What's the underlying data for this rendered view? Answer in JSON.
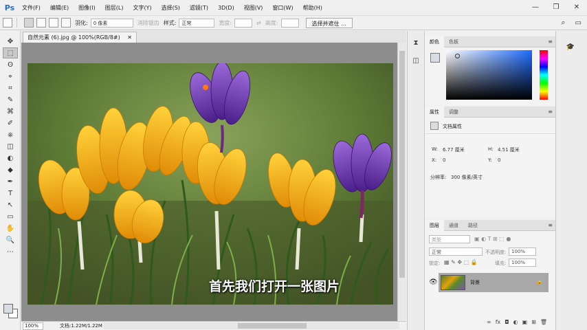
{
  "app": {
    "logo": "Ps"
  },
  "menu": [
    "文件(F)",
    "编辑(E)",
    "图像(I)",
    "图层(L)",
    "文字(Y)",
    "选择(S)",
    "滤镜(T)",
    "3D(D)",
    "视图(V)",
    "窗口(W)",
    "帮助(H)"
  ],
  "window_controls": {
    "minimize": "—",
    "restore": "❐",
    "close": "✕"
  },
  "options": {
    "feather_label": "羽化:",
    "feather_value": "0 像素",
    "antialias_label": "消除锯齿",
    "style_label": "样式:",
    "style_value": "正常",
    "width_label": "宽度:",
    "height_label": "高度:",
    "select_mask_button": "选择并遮住 ..."
  },
  "tools": [
    "✥",
    "⬚",
    "ʘ",
    "⌖",
    "⌗",
    "✎",
    "⌘",
    "✐",
    "⎈",
    "◫",
    "◐",
    "◆",
    "✒",
    "T",
    "↖",
    "▭",
    "✋",
    "🔍",
    "⋯"
  ],
  "document": {
    "tab_title": "自然元素 (6).jpg @ 100%(RGB/8#)",
    "close_glyph": "✕",
    "caption": "首先我们打开一张图片"
  },
  "status": {
    "zoom": "100%",
    "doc": "文档:1.22M/1.22M",
    "arrow": "›"
  },
  "color_panel": {
    "tabs": [
      "颜色",
      "色板"
    ],
    "fg_color": "#d8dde4",
    "bg_color": "#ffffff"
  },
  "properties_panel": {
    "tabs": [
      "属性",
      "调整"
    ],
    "title": "文档属性",
    "w_label": "W:",
    "w_value": "6.77 厘米",
    "h_label": "H:",
    "h_value": "4.51 厘米",
    "x_label": "X:",
    "x_value": "0",
    "y_label": "Y:",
    "y_value": "0",
    "resolution_label": "分辨率:",
    "resolution_value": "300 像素/英寸"
  },
  "layers_panel": {
    "tabs": [
      "图层",
      "通道",
      "路径"
    ],
    "filter_placeholder": "类型",
    "blend_mode": "正常",
    "opacity_label": "不透明度:",
    "opacity_value": "100%",
    "lock_label": "锁定:",
    "fill_label": "填充:",
    "fill_value": "100%",
    "layer_name": "背景",
    "footer_icons": [
      "∞",
      "fx",
      "◘",
      "◐",
      "▣",
      "⊞",
      "🗑"
    ]
  }
}
